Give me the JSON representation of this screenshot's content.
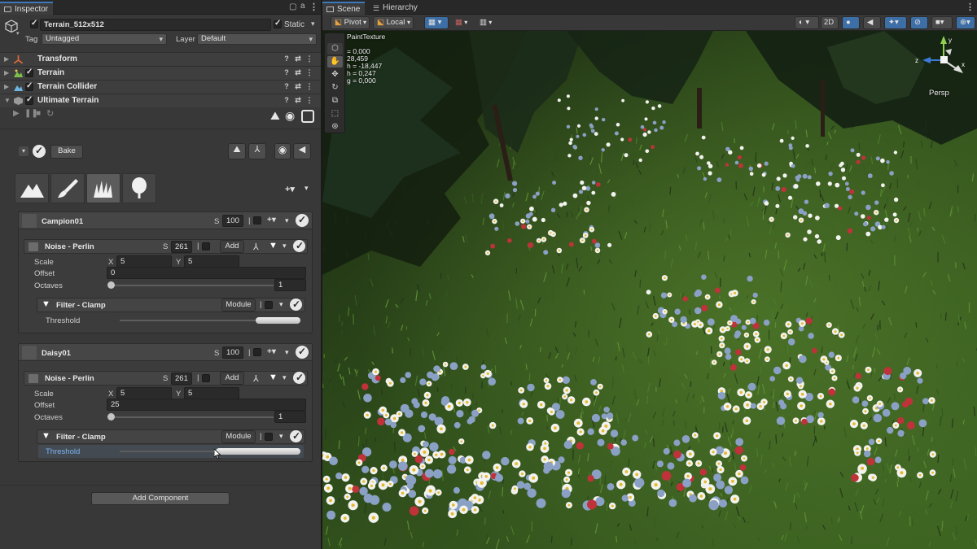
{
  "inspector": {
    "tab_label": "Inspector",
    "object": {
      "name": "Terrain_512x512",
      "static_label": "Static",
      "tag_label": "Tag",
      "tag_value": "Untagged",
      "layer_label": "Layer",
      "layer_value": "Default"
    },
    "components": [
      {
        "name": "Transform"
      },
      {
        "name": "Terrain"
      },
      {
        "name": "Terrain Collider"
      },
      {
        "name": "Ultimate Terrain"
      }
    ],
    "bake_label": "Bake",
    "layers": [
      {
        "name": "Campion01",
        "s_label": "S",
        "s_value": "100",
        "noise": {
          "title": "Noise - Perlin",
          "s_label": "S",
          "s_value": "261",
          "add_label": "Add",
          "scale_label": "Scale",
          "x_label": "X",
          "x_value": "5",
          "y_label": "Y",
          "y_value": "5",
          "offset_label": "Offset",
          "offset_value": "0",
          "octaves_label": "Octaves",
          "octaves_value": "1"
        },
        "filter": {
          "title": "Filter - Clamp",
          "mode_label": "Module",
          "threshold_label": "Threshold",
          "threshold_min": 0.75,
          "threshold_max": 1.0
        }
      },
      {
        "name": "Daisy01",
        "s_label": "S",
        "s_value": "100",
        "noise": {
          "title": "Noise - Perlin",
          "s_label": "S",
          "s_value": "261",
          "add_label": "Add",
          "scale_label": "Scale",
          "x_label": "X",
          "x_value": "5",
          "y_label": "Y",
          "y_value": "5",
          "offset_label": "Offset",
          "offset_value": "25",
          "octaves_label": "Octaves",
          "octaves_value": "1"
        },
        "filter": {
          "title": "Filter - Clamp",
          "mode_label": "Module",
          "threshold_label": "Threshold",
          "threshold_min": 0.53,
          "threshold_max": 1.0
        }
      }
    ],
    "add_component_label": "Add Component"
  },
  "scene": {
    "tabs": [
      "Scene",
      "Hierarchy"
    ],
    "pivot_label": "Pivot",
    "local_label": "Local",
    "mode_2d_label": "2D",
    "persp_label": "Persp",
    "overlay_title": "PaintTexture",
    "overlay_lines": [
      "= 0,000",
      "28,459",
      "h = -18,447",
      "h = 0,247",
      "g = 0,000"
    ],
    "gizmo_axes": [
      "y",
      "z",
      "x"
    ]
  },
  "colors": {
    "accent": "#3a79bb",
    "panel_bg": "#383838",
    "grass_dark": "#1e2e14",
    "grass_mid": "#3f6a22",
    "daisy_white": "#f2f2ee",
    "daisy_blue": "#8aa0c4",
    "campion_red": "#c0323a"
  }
}
